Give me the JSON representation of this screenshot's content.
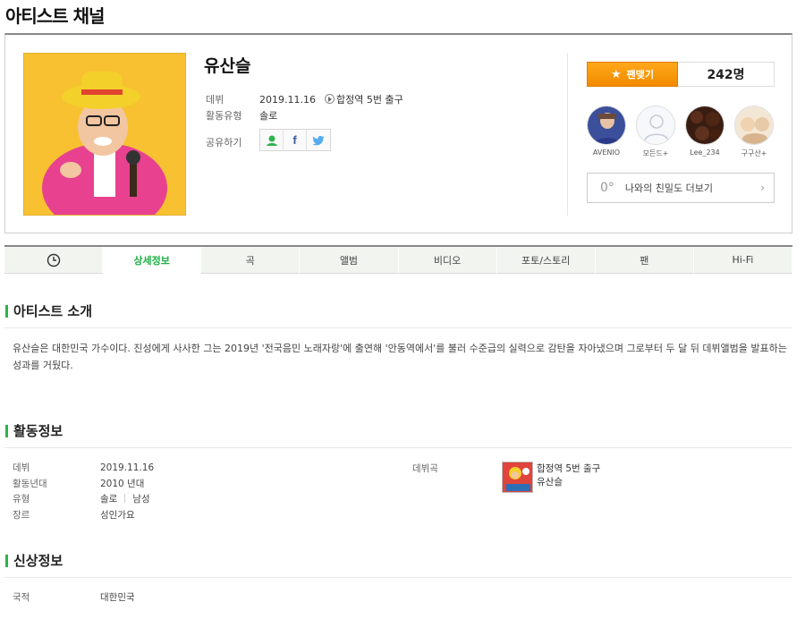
{
  "page_title": "아티스트 채널",
  "artist": {
    "name": "유산슬",
    "debut_label": "데뷔",
    "debut_date": "2019.11.16",
    "debut_song": "합정역 5번 출구",
    "type_label": "활동유형",
    "type_value": "솔로",
    "share_label": "공유하기"
  },
  "fan": {
    "button_label": "팬맺기",
    "count": "242명",
    "fans": [
      {
        "name": "AVENIO"
      },
      {
        "name": "모든드+"
      },
      {
        "name": "Lee_234"
      },
      {
        "name": "구구산+"
      }
    ],
    "closeness_degree": "0°",
    "closeness_label": "나와의 친밀도 더보기"
  },
  "tabs": [
    "상세정보",
    "곡",
    "앨범",
    "비디오",
    "포토/스토리",
    "팬",
    "Hi-Fi"
  ],
  "intro": {
    "title": "아티스트 소개",
    "text": "유산슬은 대한민국 가수이다. 진성에게 사사한 그는 2019년 '전국음민 노래자랑'에 출연해 '안동역에서'를 불러 수준급의 실력으로 감탄을 자아냈으며 그로부터 두 달 뒤 데뷔앨범을 발표하는 성과를 거뒀다."
  },
  "activity": {
    "title": "활동정보",
    "debut_label": "데뷔",
    "debut_value": "2019.11.16",
    "era_label": "활동년대",
    "era_value": "2010 년대",
    "type_label": "유형",
    "type_value1": "솔로",
    "type_value2": "남성",
    "genre_label": "장르",
    "genre_value": "성인가요",
    "debut_song_label": "데뷔곡",
    "debut_song_title": "합정역 5번 출구",
    "debut_song_artist": "유산슬"
  },
  "personal": {
    "title": "신상정보",
    "nationality_label": "국적",
    "nationality_value": "대한민국"
  },
  "colors": {
    "accent_green": "#2cb34b",
    "fan_orange": "#f59a00",
    "photo_yellow": "#f7c131"
  }
}
